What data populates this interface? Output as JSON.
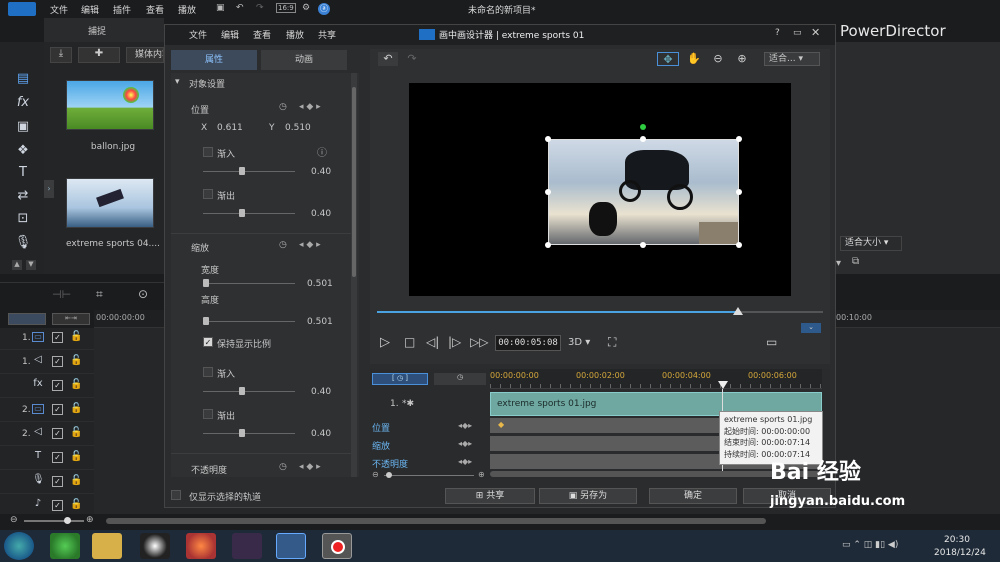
{
  "main_window": {
    "title": "未命名的新项目*",
    "menu": [
      "文件",
      "编辑",
      "插件",
      "查看",
      "播放"
    ],
    "brand": "PowerDirector",
    "tab_capture": "捕捉",
    "media_tab": "媒体内容",
    "media_items": [
      {
        "label": "ballon.jpg"
      },
      {
        "label": "extreme sports 04...."
      }
    ],
    "fit_select": "适合大小",
    "timeline_start": "00:00:00:00",
    "timeline_end": "00:10:00",
    "tracks": [
      {
        "num": "1.",
        "icon": "video-track-icon"
      },
      {
        "num": "1.",
        "icon": "audio-track-icon"
      },
      {
        "num": "",
        "icon": "fx-track-icon"
      },
      {
        "num": "2.",
        "icon": "video-track-icon"
      },
      {
        "num": "2.",
        "icon": "audio-track-icon"
      },
      {
        "num": "",
        "icon": "title-track-icon"
      },
      {
        "num": "",
        "icon": "voice-track-icon"
      },
      {
        "num": "",
        "icon": "music-track-icon"
      }
    ]
  },
  "dialog": {
    "title": "画中画设计器 | extreme sports 01",
    "menu": [
      "文件",
      "编辑",
      "查看",
      "播放",
      "共享"
    ],
    "tabs": [
      "属性",
      "动画"
    ],
    "section_object": "对象设置",
    "position_label": "位置",
    "x_label": "X",
    "x_value": "0.611",
    "y_label": "Y",
    "y_value": "0.510",
    "fade_in": "渐入",
    "fade_out": "渐出",
    "fade_in_value": "0.40",
    "fade_out_value": "0.40",
    "scale_label": "缩放",
    "width_label": "宽度",
    "width_value": "0.501",
    "height_label": "高度",
    "height_value": "0.501",
    "keep_ratio": "保持显示比例",
    "scale_fade_in_value": "0.40",
    "scale_fade_out_value": "0.40",
    "opacity_label": "不透明度",
    "show_selected_tracks": "仅显示选择的轨道",
    "fit_dropdown": "适合...",
    "timecode": "00:00:05:08",
    "mode_3d": "3D",
    "ruler_ticks": [
      "00:00:00:00",
      "00:00:02:00",
      "00:00:04:00",
      "00:00:06:00"
    ],
    "clip_track_label": "1.",
    "clip_name": "extreme sports 01.jpg",
    "kf_rows": [
      "位置",
      "缩放",
      "不透明度"
    ],
    "tooltip": {
      "name": "extreme sports 01.jpg",
      "start": "起始时间: 00:00:00:00",
      "end": "结束时间: 00:00:07:14",
      "duration": "持续时间: 00:00:07:14"
    },
    "buttons": {
      "share": "共享",
      "save_as": "另存为",
      "ok": "确定",
      "cancel": "取消"
    },
    "playback_progress": 0.81
  },
  "taskbar": {
    "time": "20:30",
    "date": "2018/12/24"
  },
  "watermark": {
    "text": "Bai 经验",
    "url": "jingyan.baidu.com"
  },
  "colors": {
    "accent_blue": "#4a90d9",
    "clip_teal": "#6ea8a0",
    "panel_dark": "#2b2c2e"
  }
}
